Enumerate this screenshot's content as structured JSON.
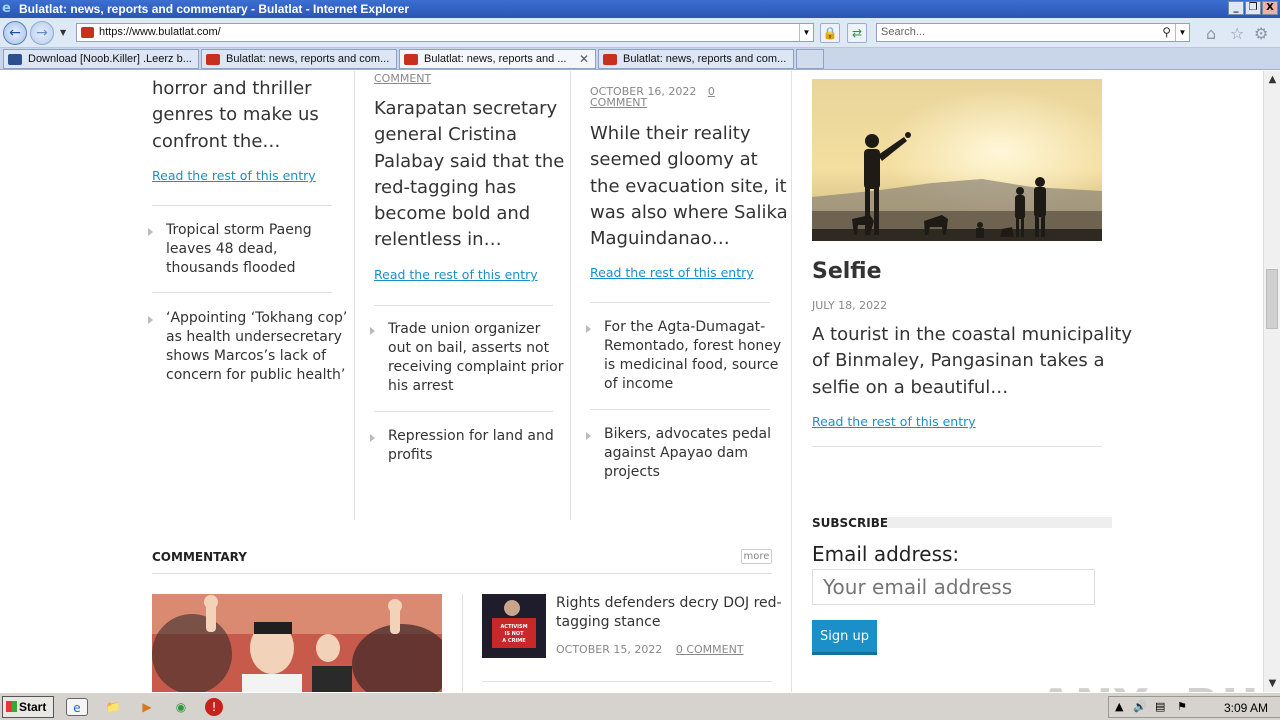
{
  "window": {
    "title": "Bulatlat: news, reports and commentary - Bulatlat - Internet Explorer",
    "min_label": "_",
    "restore_label": "❐",
    "close_label": "X"
  },
  "nav": {
    "back_icon": "back-arrow-icon",
    "url": "https://www.bulatlat.com/",
    "search_placeholder": "Search..."
  },
  "tabs": [
    {
      "label": "Download [Noob.Killer] .Leerz b..."
    },
    {
      "label": "Bulatlat: news, reports and com..."
    },
    {
      "label": "Bulatlat: news, reports and ...",
      "active": true
    },
    {
      "label": "Bulatlat: news, reports and com..."
    }
  ],
  "col1": {
    "excerpt_lines": [
      "horror and thriller",
      "genres to make us",
      "confront the…"
    ],
    "read_more": "Read the rest of this entry",
    "related": [
      {
        "title_lines": [
          "Tropical storm Paeng",
          "leaves 48 dead,",
          "thousands flooded"
        ]
      },
      {
        "title_lines": [
          "‘Appointing ‘Tokhang cop’",
          "as health undersecretary",
          "shows Marcos’s lack of",
          "concern for public health’"
        ]
      }
    ]
  },
  "col2": {
    "meta_comment": "COMMENT",
    "excerpt_lines": [
      "Karapatan secretary",
      "general Cristina",
      "Palabay said that the",
      "red-tagging has",
      "become bold and",
      "relentless in…"
    ],
    "read_more": "Read the rest of this entry",
    "related": [
      {
        "title_lines": [
          "Trade union organizer",
          "out on bail, asserts not",
          "receiving complaint prior",
          "his arrest"
        ]
      },
      {
        "title_lines": [
          "Repression for land and",
          "profits"
        ]
      }
    ]
  },
  "col3": {
    "meta_date": "OCTOBER 16, 2022",
    "meta_count": "0",
    "meta_comment": "COMMENT",
    "excerpt_lines": [
      "While their reality",
      "seemed gloomy at",
      "the evacuation site, it",
      "was also where Salika",
      "Maguindanao…"
    ],
    "read_more": "Read the rest of this entry",
    "related": [
      {
        "title_lines": [
          "For the Agta-Dumagat-",
          "Remontado, forest honey",
          "is medicinal food, source",
          "of income"
        ]
      },
      {
        "title_lines": [
          "Bikers, advocates pedal",
          "against Apayao dam",
          "projects"
        ]
      }
    ]
  },
  "sidebar": {
    "photo_title": "Selfie",
    "photo_date": "JULY 18, 2022",
    "excerpt_lines": [
      "A tourist in the coastal municipality",
      "of Binmaley, Pangasinan takes a",
      "selfie on a beautiful…"
    ],
    "read_more": "Read the rest of this entry",
    "subscribe_heading": "SUBSCRIBE",
    "email_label": "Email address:",
    "email_placeholder": "Your email address",
    "signup_label": "Sign up"
  },
  "commentary": {
    "heading": "COMMENTARY",
    "more_label": "more",
    "item": {
      "title_lines": [
        "Rights defenders decry DOJ red-",
        "tagging stance"
      ],
      "date": "OCTOBER 15, 2022",
      "comments": "0 COMMENT",
      "thumb_text": "ACTIVISM IS NOT A CRIME"
    }
  },
  "taskbar": {
    "start_label": "Start",
    "clock": "3:09 AM"
  },
  "watermark": "ANY▷RUN",
  "colors": {
    "link": "#1b8fc8",
    "signup": "#1b8fc8",
    "text": "#333333"
  }
}
